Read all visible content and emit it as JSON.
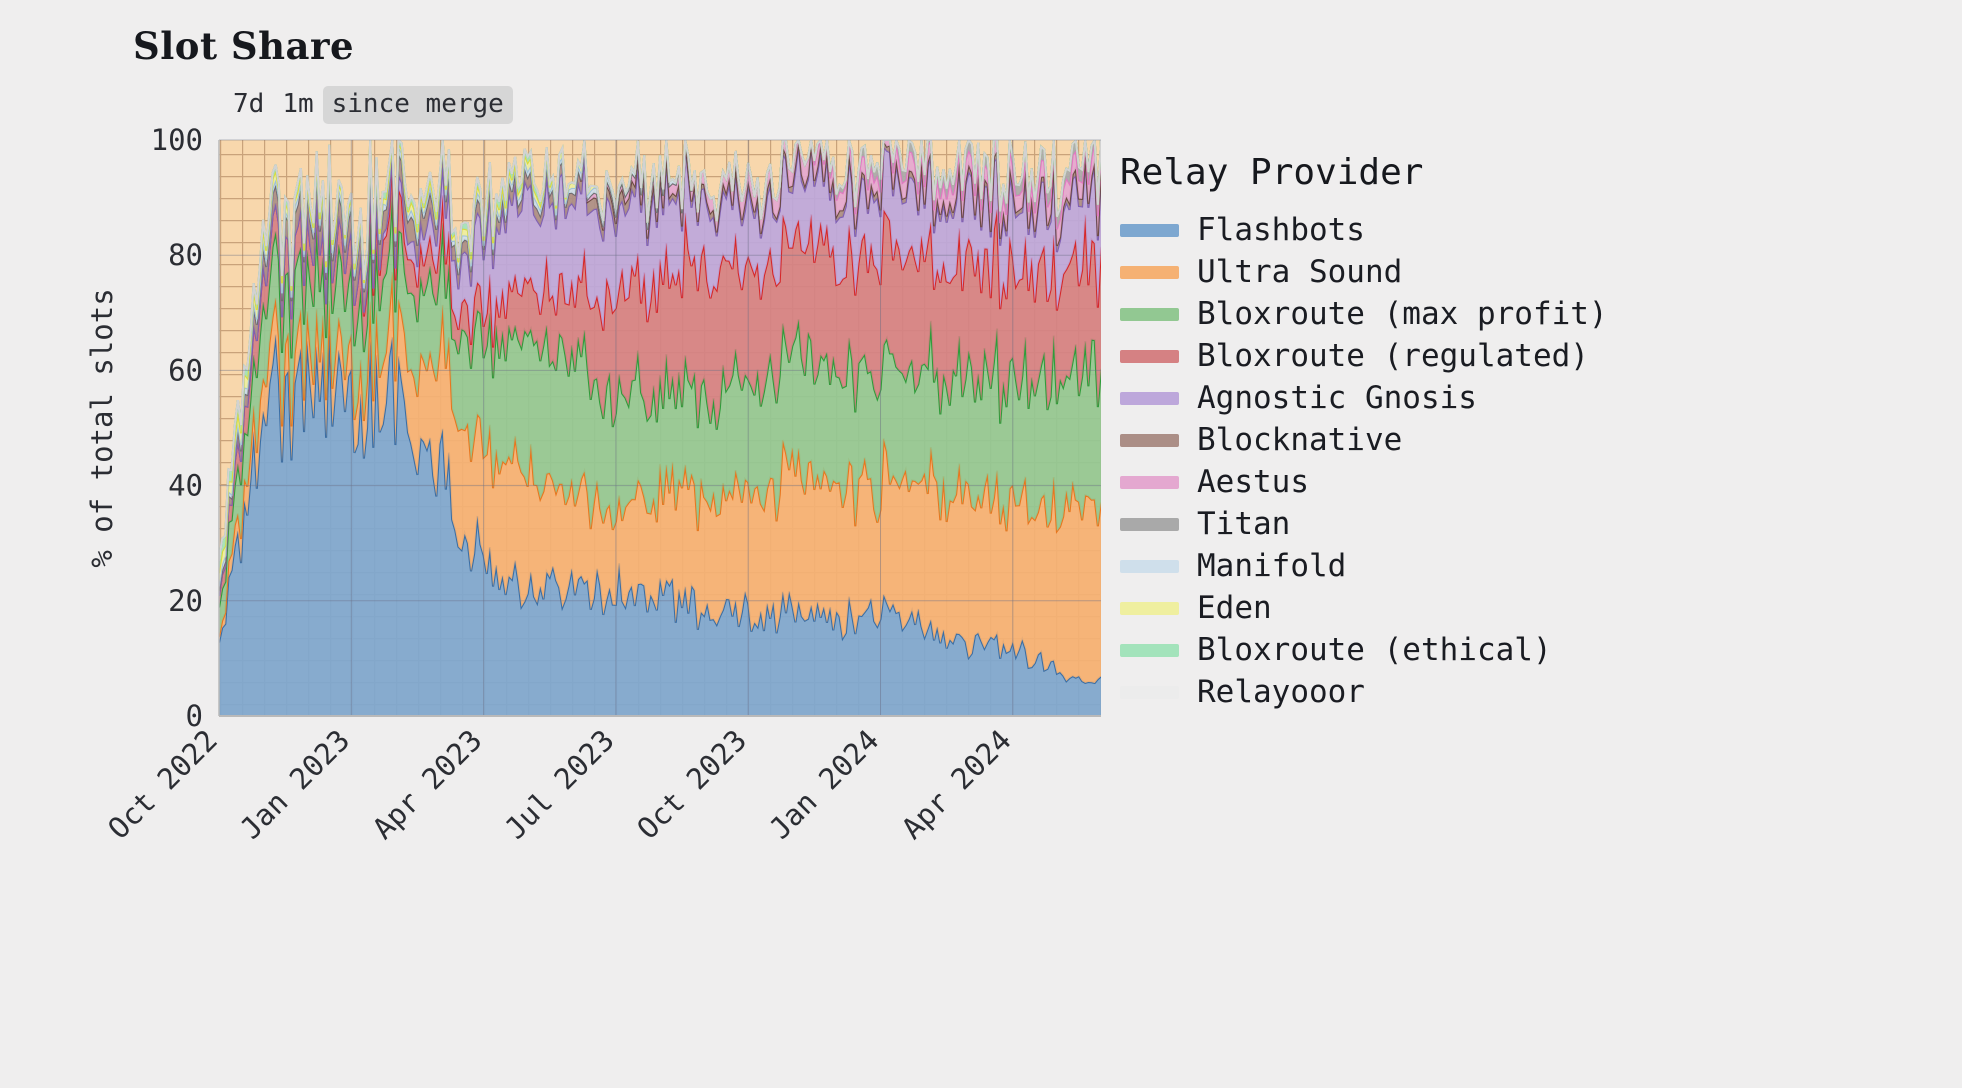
{
  "header": {
    "title": "Slot Share"
  },
  "range_toggle": {
    "options": [
      {
        "label": "7d",
        "active": false
      },
      {
        "label": "1m",
        "active": false
      },
      {
        "label": "since merge",
        "active": true
      }
    ]
  },
  "legend": {
    "title": "Relay Provider",
    "items": [
      {
        "label": "Flashbots",
        "color": "#7da7d0"
      },
      {
        "label": "Ultra Sound",
        "color": "#f5b173"
      },
      {
        "label": "Bloxroute (max profit)",
        "color": "#92c892"
      },
      {
        "label": "Bloxroute (regulated)",
        "color": "#d58183"
      },
      {
        "label": "Agnostic Gnosis",
        "color": "#bda7db"
      },
      {
        "label": "Blocknative",
        "color": "#ab8e86"
      },
      {
        "label": "Aestus",
        "color": "#e4a8d0"
      },
      {
        "label": "Titan",
        "color": "#a9a9a9"
      },
      {
        "label": "Manifold",
        "color": "#cfdfeb"
      },
      {
        "label": "Eden",
        "color": "#efef9f"
      },
      {
        "label": "Bloxroute (ethical)",
        "color": "#a3e3bb"
      },
      {
        "label": "Relayooor",
        "color": "#ececec"
      }
    ]
  },
  "chart_data": {
    "type": "area",
    "stacked": true,
    "title": "Slot Share",
    "xlabel": "",
    "ylabel": "% of total slots",
    "ylim": [
      0,
      100
    ],
    "yticks": [
      0,
      20,
      40,
      60,
      80,
      100
    ],
    "grid": true,
    "legend_position": "right",
    "background_hatch": {
      "color": "#f8d7ac",
      "line_color": "#c9a27a",
      "note": "cross-hatched region fills plot background above stacked areas"
    },
    "x": [
      "Oct 2022",
      "Nov 2022",
      "Dec 2022",
      "Jan 2023",
      "Feb 2023",
      "Mar 2023",
      "Apr 2023",
      "May 2023",
      "Jun 2023",
      "Jul 2023",
      "Aug 2023",
      "Sep 2023",
      "Oct 2023",
      "Nov 2023",
      "Dec 2023",
      "Jan 2024",
      "Feb 2024",
      "Mar 2024",
      "Apr 2024",
      "May 2024",
      "Jun 2024"
    ],
    "xticks": [
      "Oct 2022",
      "Jan 2023",
      "Apr 2023",
      "Jul 2023",
      "Oct 2023",
      "Jan 2024",
      "Apr 2024"
    ],
    "series": [
      {
        "name": "Flashbots",
        "color": "#7da7d0",
        "line": "#3a6ea5",
        "values": [
          12,
          52,
          58,
          57,
          55,
          44,
          26,
          22,
          23,
          22,
          21,
          19,
          18,
          18,
          17,
          18,
          16,
          13,
          12,
          8,
          6
        ]
      },
      {
        "name": "Ultra Sound",
        "color": "#f5b173",
        "line": "#e8761e",
        "values": [
          1,
          7,
          6,
          6,
          10,
          18,
          19,
          20,
          17,
          14,
          17,
          21,
          22,
          24,
          23,
          23,
          25,
          26,
          26,
          29,
          29
        ]
      },
      {
        "name": "Bloxroute (max profit)",
        "color": "#92c892",
        "line": "#2e9c3a",
        "values": [
          5,
          12,
          13,
          13,
          12,
          14,
          17,
          24,
          24,
          20,
          17,
          17,
          18,
          20,
          20,
          20,
          19,
          21,
          21,
          23,
          24
        ]
      },
      {
        "name": "Bloxroute (regulated)",
        "color": "#d58183",
        "line": "#d62728",
        "values": [
          2,
          6,
          6,
          6,
          6,
          5,
          5,
          9,
          12,
          18,
          20,
          21,
          21,
          19,
          20,
          20,
          20,
          19,
          19,
          18,
          19
        ]
      },
      {
        "name": "Agnostic Gnosis",
        "color": "#bda7db",
        "line": "#7f5fb5",
        "values": [
          0,
          0,
          0,
          0,
          2,
          6,
          13,
          15,
          15,
          14,
          14,
          12,
          11,
          11,
          11,
          11,
          11,
          11,
          11,
          11,
          12
        ]
      },
      {
        "name": "Blocknative",
        "color": "#ab8e86",
        "line": "#6b4a42",
        "values": [
          1,
          3,
          4,
          4,
          4,
          3,
          2,
          2,
          2,
          2,
          1,
          1,
          1,
          1,
          1,
          1,
          1,
          1,
          1,
          1,
          1
        ]
      },
      {
        "name": "Aestus",
        "color": "#e4a8d0",
        "line": "#e377c2",
        "values": [
          0,
          0,
          0,
          0,
          0,
          0,
          0,
          0,
          0,
          1,
          2,
          2,
          3,
          3,
          3,
          3,
          3,
          3,
          3,
          3,
          3
        ]
      },
      {
        "name": "Titan",
        "color": "#a9a9a9",
        "line": "#6e6e6e",
        "values": [
          0,
          0,
          0,
          0,
          0,
          0,
          0,
          0,
          0,
          0,
          0,
          0,
          0,
          0,
          1,
          2,
          2,
          2,
          2,
          2,
          2
        ]
      },
      {
        "name": "Manifold",
        "color": "#cfdfeb",
        "line": "#9fc0d8",
        "values": [
          1,
          1,
          1,
          1,
          1,
          1,
          1,
          1,
          1,
          1,
          1,
          0,
          0,
          0,
          0,
          0,
          0,
          0,
          0,
          0,
          0
        ]
      },
      {
        "name": "Eden",
        "color": "#efef9f",
        "line": "#dada3c",
        "values": [
          2,
          2,
          1,
          1,
          1,
          1,
          1,
          1,
          1,
          0,
          0,
          0,
          0,
          0,
          0,
          0,
          0,
          0,
          0,
          0,
          0
        ]
      },
      {
        "name": "Bloxroute (ethical)",
        "color": "#a3e3bb",
        "line": "#4fbf7d",
        "values": [
          2,
          1,
          1,
          1,
          1,
          1,
          1,
          1,
          0,
          0,
          0,
          0,
          0,
          0,
          0,
          0,
          0,
          0,
          0,
          0,
          0
        ]
      },
      {
        "name": "Relayooor",
        "color": "#ececec",
        "line": "#d2d2d2",
        "values": [
          0,
          0,
          0,
          0,
          0,
          0,
          0,
          0,
          0,
          0,
          0,
          0,
          0,
          0,
          0,
          0,
          0,
          0,
          0,
          0,
          0
        ]
      }
    ]
  }
}
